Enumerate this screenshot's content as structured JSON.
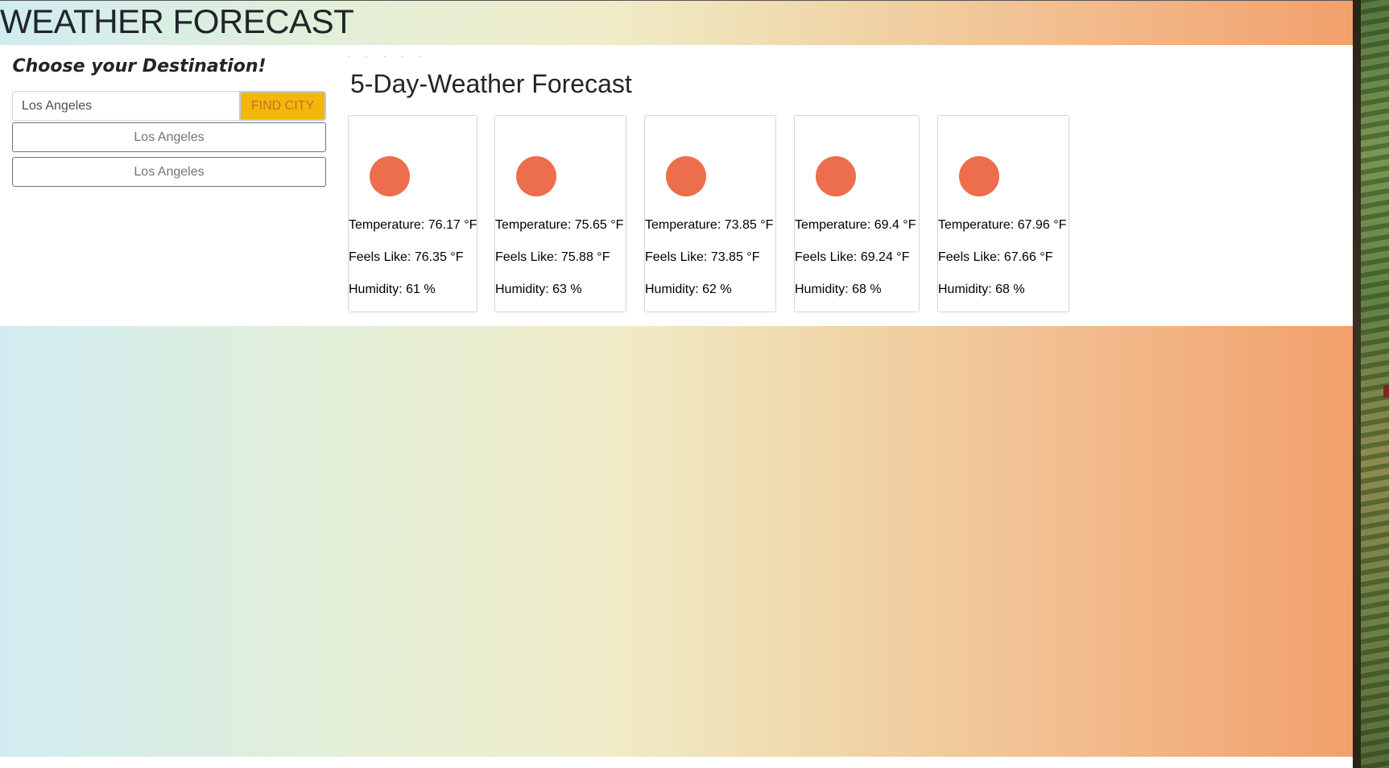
{
  "header": {
    "title": "WEATHER FORECAST"
  },
  "sidebar": {
    "title": "Choose your Destination!",
    "search": {
      "value": "Los Angeles",
      "button_label": "FIND CITY"
    },
    "history": [
      {
        "label": "Los Angeles"
      },
      {
        "label": "Los Angeles"
      }
    ]
  },
  "main": {
    "title": "5-Day-Weather Forecast",
    "cards": [
      {
        "temperature": "Temperature: 76.17 °F",
        "feels_like": "Feels Like: 76.35 °F",
        "humidity": "Humidity: 61 %"
      },
      {
        "temperature": "Temperature: 75.65 °F",
        "feels_like": "Feels Like: 75.88 °F",
        "humidity": "Humidity: 63 %"
      },
      {
        "temperature": "Temperature: 73.85 °F",
        "feels_like": "Feels Like: 73.85 °F",
        "humidity": "Humidity: 62 %"
      },
      {
        "temperature": "Temperature: 69.4 °F",
        "feels_like": "Feels Like: 69.24 °F",
        "humidity": "Humidity: 68 %"
      },
      {
        "temperature": "Temperature: 67.96 °F",
        "feels_like": "Feels Like: 67.66 °F",
        "humidity": "Humidity: 68 %"
      }
    ]
  },
  "colors": {
    "accent_button": "#f5b60a",
    "weather_icon": "#ec6e4c",
    "gradient_start": "#d1ecf1",
    "gradient_end": "#f2a06c"
  },
  "icons": {
    "weather_icon": "sun-icon"
  }
}
